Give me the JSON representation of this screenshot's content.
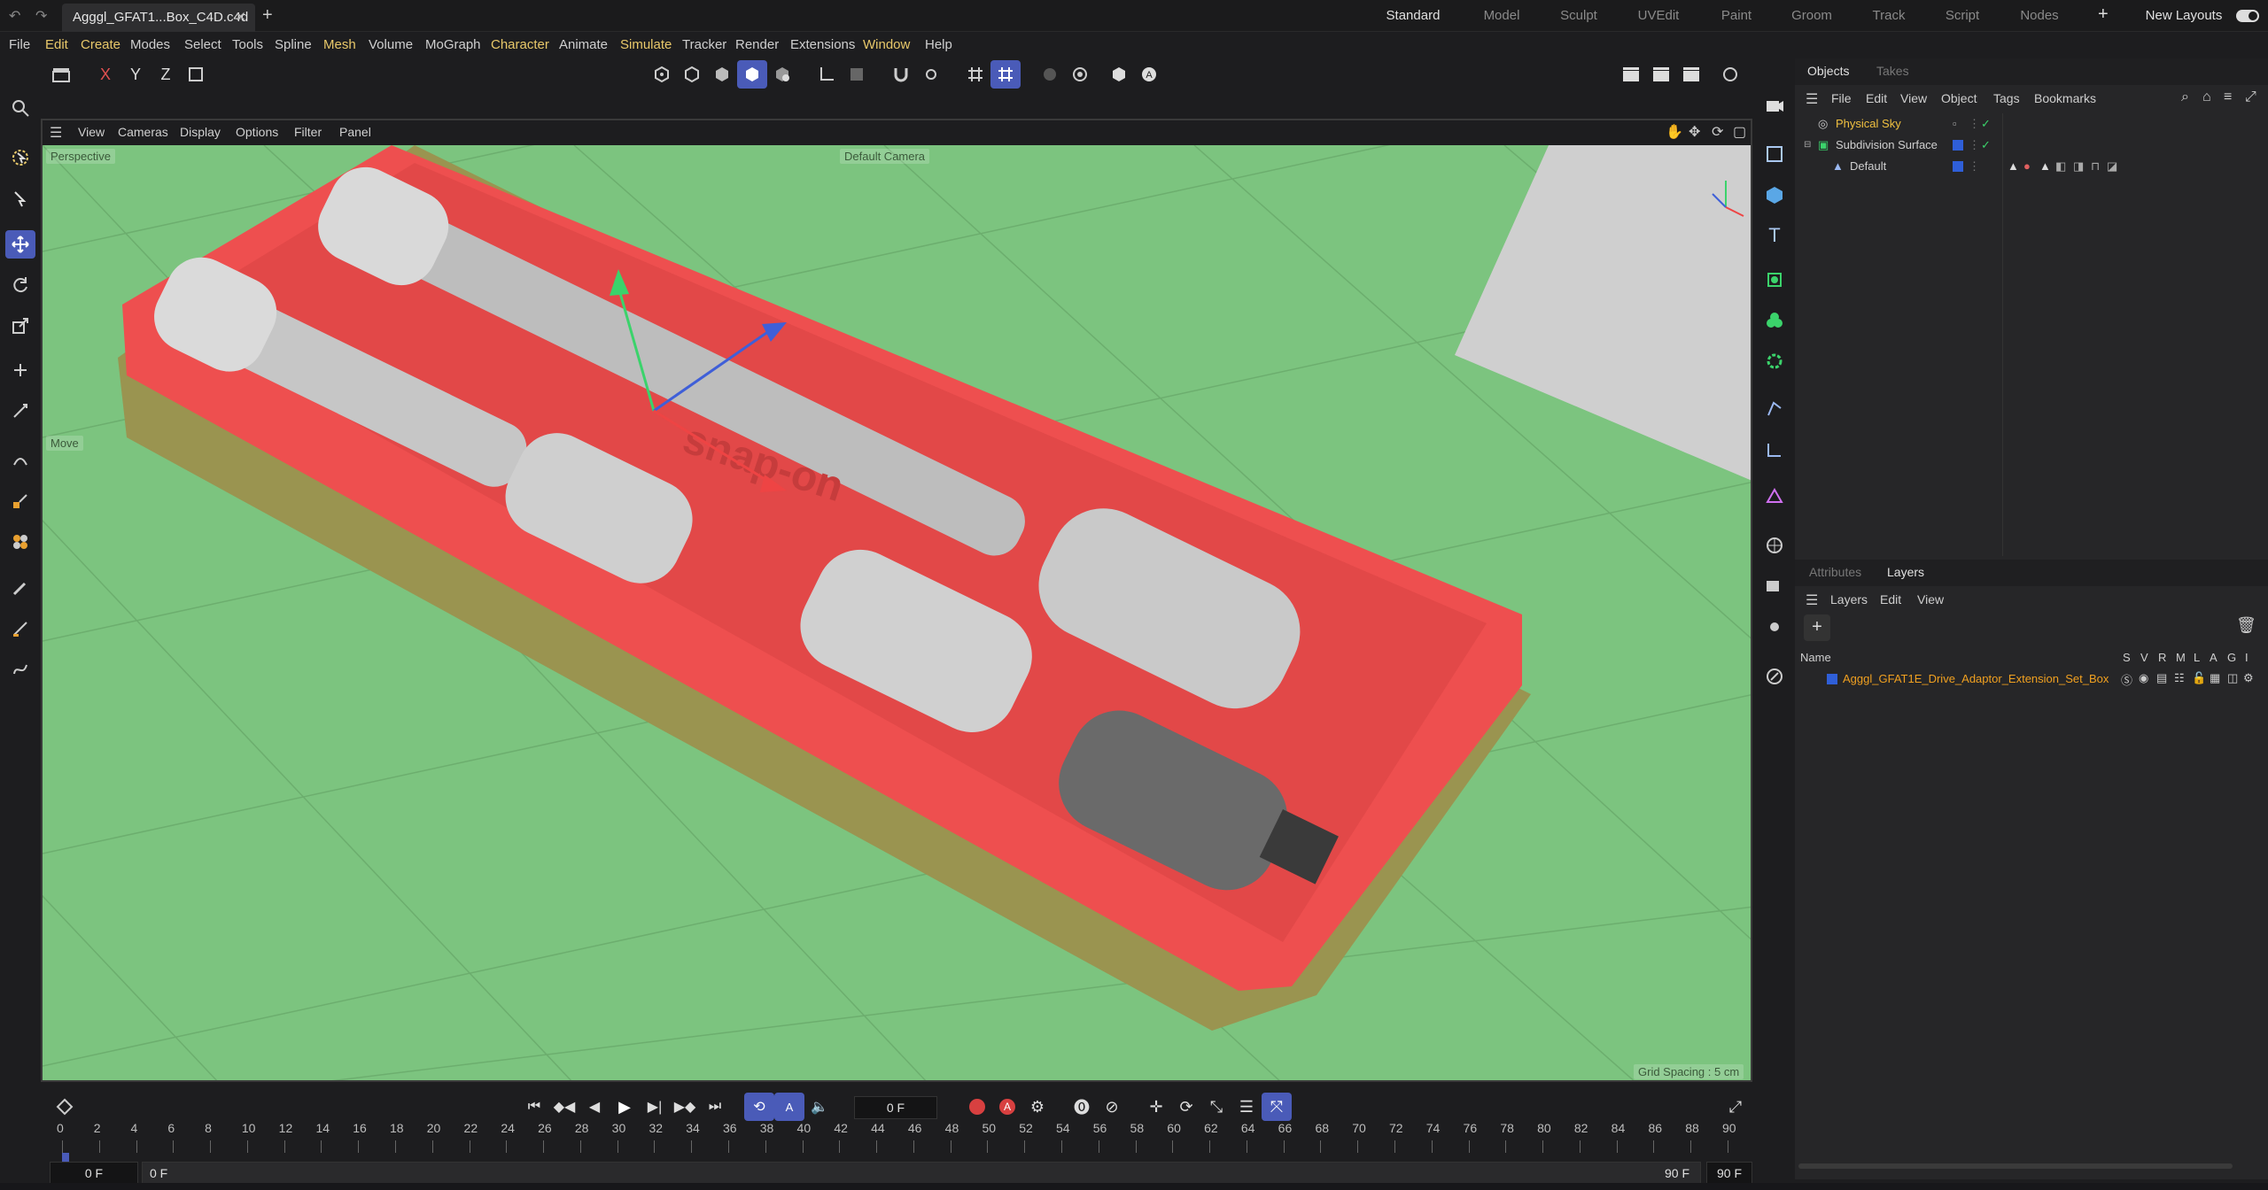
{
  "titlebar": {
    "doc_tab": "Agggl_GFAT1...Box_C4D.c4d",
    "layouts": [
      "Standard",
      "Model",
      "Sculpt",
      "UVEdit",
      "Paint",
      "Groom",
      "Track",
      "Script",
      "Nodes"
    ],
    "active_layout": "Standard",
    "new_layouts": "New Layouts"
  },
  "menubar": {
    "items": [
      "File",
      "Edit",
      "Create",
      "Modes",
      "Select",
      "Tools",
      "Spline",
      "Mesh",
      "Volume",
      "MoGraph",
      "Character",
      "Animate",
      "Simulate",
      "Tracker",
      "Render",
      "Extensions",
      "Window",
      "Help"
    ],
    "highlighted": [
      "Edit",
      "Create",
      "Mesh",
      "Character",
      "Simulate",
      "Window"
    ]
  },
  "toolbar": {
    "axes": [
      "X",
      "Y",
      "Z"
    ]
  },
  "viewport": {
    "menu": [
      "View",
      "Cameras",
      "Display",
      "Options",
      "Filter",
      "Panel"
    ],
    "view_name": "Perspective",
    "camera": "Default Camera",
    "tool_hud": "Move",
    "grid_spacing": "Grid Spacing : 5 cm",
    "tray_text": "snap-on",
    "tray_color": "#ee4f4f",
    "ground_color": "#7cc47f",
    "accent": "#4a5bb8"
  },
  "objects_panel": {
    "tabs": [
      "Objects",
      "Takes"
    ],
    "menu": [
      "File",
      "Edit",
      "View",
      "Object",
      "Tags",
      "Bookmarks"
    ],
    "rows": [
      {
        "name": "Physical Sky",
        "color": "#f0c040"
      },
      {
        "name": "Subdivision Surface",
        "color": "#cfcfcf"
      },
      {
        "name": "Default",
        "color": "#cfcfcf"
      }
    ]
  },
  "layers_panel": {
    "tabs": [
      "Attributes",
      "Layers"
    ],
    "menu": [
      "Layers",
      "Edit",
      "View"
    ],
    "columns": [
      "Name",
      "S",
      "V",
      "R",
      "M",
      "L",
      "A",
      "G",
      "I"
    ],
    "layer_name": "Agggl_GFAT1E_Drive_Adaptor_Extension_Set_Box",
    "layer_color": "#f0a020"
  },
  "timeline": {
    "current_frame": "0 F",
    "ticks": [
      "0",
      "2",
      "4",
      "6",
      "8",
      "10",
      "12",
      "14",
      "16",
      "18",
      "20",
      "22",
      "24",
      "26",
      "28",
      "30",
      "32",
      "34",
      "36",
      "38",
      "40",
      "42",
      "44",
      "46",
      "48",
      "50",
      "52",
      "54",
      "56",
      "58",
      "60",
      "62",
      "64",
      "66",
      "68",
      "70",
      "72",
      "74",
      "76",
      "78",
      "80",
      "82",
      "84",
      "86",
      "88",
      "90"
    ],
    "start_field": "0 F",
    "range_start": "0 F",
    "range_end": "90 F",
    "end_field": "90 F"
  }
}
